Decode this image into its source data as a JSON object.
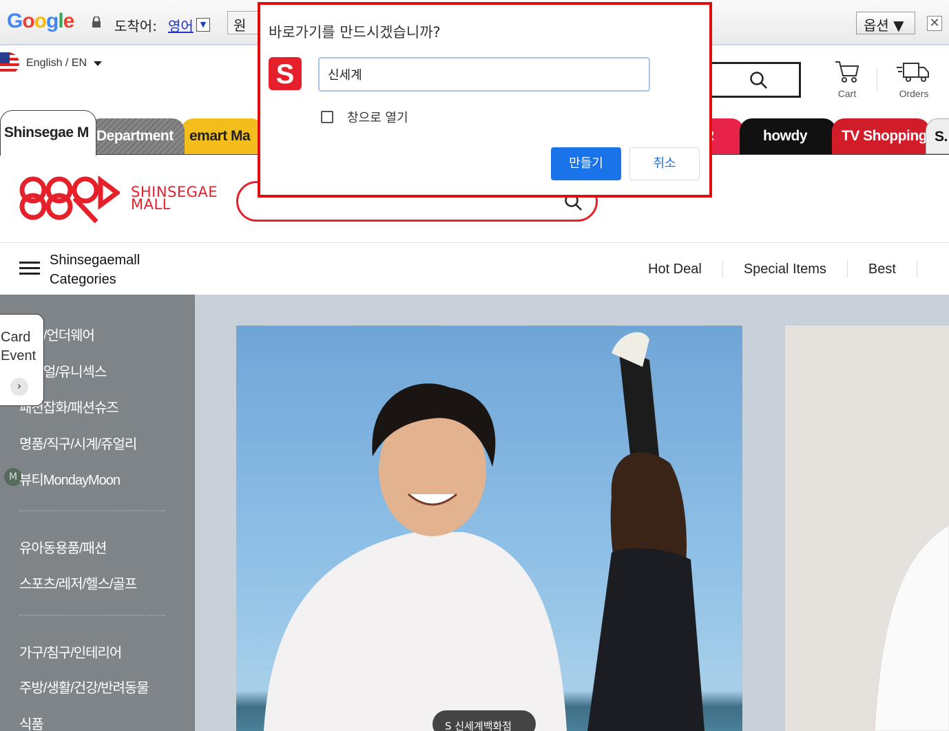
{
  "translate_bar": {
    "logo_text": "Google",
    "destination_label": "도착어:",
    "destination_language": "영어",
    "original_button": "원",
    "options_label": "옵션 ▼",
    "close_label": "✕"
  },
  "header": {
    "language": "English / EN",
    "cart_label": "Cart",
    "orders_label": "Orders"
  },
  "mall_tabs": [
    {
      "label": "Shinsegae M"
    },
    {
      "label": "Department"
    },
    {
      "label": "emart Ma"
    },
    {
      "label": "R"
    },
    {
      "label": "howdy"
    },
    {
      "label": "TV Shopping"
    },
    {
      "label": "S."
    }
  ],
  "brand": {
    "line1": "SHINSEGAE",
    "line2": "MALL",
    "color": "#e5202a"
  },
  "categories": {
    "title_line1": "Shinsegaemall",
    "title_line2": "Categories"
  },
  "top_nav": [
    "Hot Deal",
    "Special Items",
    "Best"
  ],
  "sidebar": {
    "items": [
      "패션/언더웨어",
      "캐쥬얼/유니섹스",
      "패션잡화/패션슈즈",
      "명품/직구/시계/쥬얼리",
      "뷰티MondayMoon",
      "유아동용품/패션",
      "스포츠/레저/헬스/골프",
      "가구/침구/인테리어",
      "주방/생활/건강/반려동물",
      "식품"
    ],
    "m_badge": "M"
  },
  "card_event": {
    "line1": "Card",
    "line2": "Event"
  },
  "banner": {
    "badge_text": "S 신세계백화점"
  },
  "dialog": {
    "title": "바로가기를 만드시겠습니까?",
    "favicon_letter": "S",
    "name_value": "신세계",
    "checkbox_label": "창으로 열기",
    "create_label": "만들기",
    "cancel_label": "취소"
  }
}
